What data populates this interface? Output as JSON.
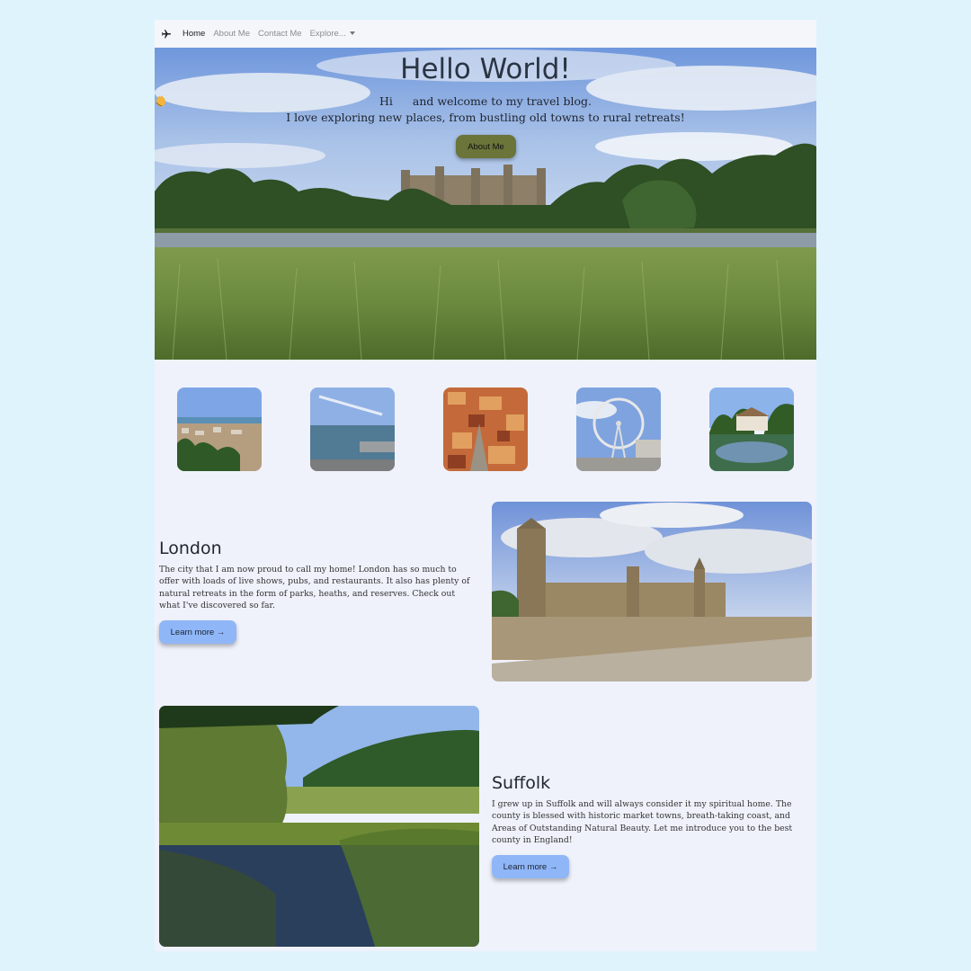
{
  "nav": {
    "items": [
      {
        "label": "Home",
        "active": true
      },
      {
        "label": "About Me",
        "active": false
      },
      {
        "label": "Contact Me",
        "active": false
      },
      {
        "label": "Explore...",
        "active": false
      }
    ],
    "logo_icon": "airplane-icon"
  },
  "hero": {
    "title": "Hello World!",
    "line1_before": "Hi",
    "wave_icon": "waving-hand-icon",
    "line1_after": "and welcome to my travel blog.",
    "line2": "I love exploring new places, from bustling old towns to rural retreats!",
    "button_label": "About Me",
    "button_color": "#6b7439"
  },
  "thumbnails": [
    {
      "name": "coastal-town"
    },
    {
      "name": "harbour"
    },
    {
      "name": "old-town-rooftops"
    },
    {
      "name": "london-eye"
    },
    {
      "name": "cottage-pond"
    }
  ],
  "sections": [
    {
      "title": "London",
      "text": "The city that I am now proud to call my home! London has so much to offer with loads of live shows, pubs, and restaurants. It also has plenty of natural retreats in the form of parks, heaths, and reserves. Check out what I've discovered so far.",
      "button_label": "Learn more →"
    },
    {
      "title": "Suffolk",
      "text": "I grew up in Suffolk and will always consider it my spiritual home. The county is blessed with historic market towns, breath-taking coast, and Areas of Outstanding Natural Beauty. Let me introduce you to the best county in England!",
      "button_label": "Learn more →"
    }
  ],
  "colors": {
    "background": "#dff3fd",
    "page": "#eff2fb",
    "learn_button": "#8fb6f7"
  }
}
